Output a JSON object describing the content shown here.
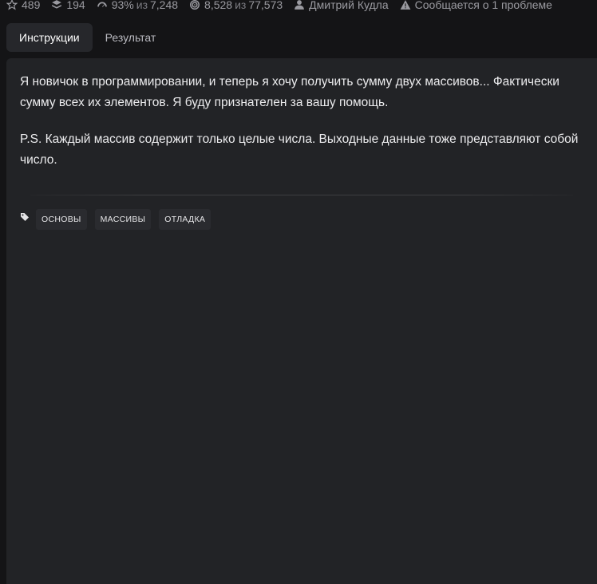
{
  "stats": {
    "stars": "489",
    "collections": "194",
    "satisfaction": "93%",
    "votes_prefix": "из",
    "votes": "7,248",
    "completed": "8,528",
    "attempts_prefix": "из",
    "attempts": "77,573",
    "author": "Дмитрий Кудла",
    "issues": "Сообщается о 1 проблеме"
  },
  "tabs": [
    {
      "label": "Инструкции",
      "active": true
    },
    {
      "label": "Результат",
      "active": false
    }
  ],
  "description": {
    "paragraph1": "Я новичок в программировании, и теперь я хочу получить сумму двух массивов... Фактически сумму всех их элементов. Я буду признателен за вашу помощь.",
    "paragraph2": "P.S. Каждый массив содержит только целые числа. Выходные данные тоже представляют собой число."
  },
  "tags": [
    "основы",
    "массивы",
    "отладка"
  ],
  "colors": {
    "background": "#141416",
    "panel": "#222326",
    "tab_active": "#26272b",
    "tag_bg": "#2a2b2f"
  },
  "icons": {
    "stars": "star-icon",
    "collections": "layers-icon",
    "satisfaction": "gauge-icon",
    "completed": "target-icon",
    "author": "user-icon",
    "issues": "warning-icon",
    "tags": "tag-icon"
  }
}
